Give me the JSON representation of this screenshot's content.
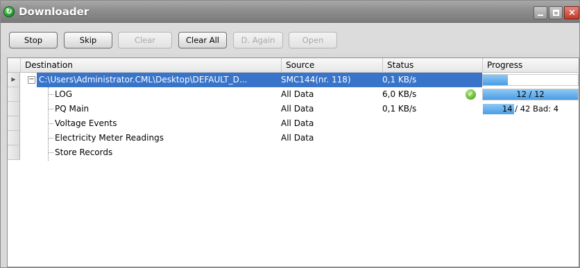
{
  "window": {
    "title": "Downloader"
  },
  "toolbar": {
    "stop": "Stop",
    "skip": "Skip",
    "clear": "Clear",
    "clear_all": "Clear All",
    "d_again": "D. Again",
    "open": "Open"
  },
  "columns": {
    "destination": "Destination",
    "source": "Source",
    "status": "Status",
    "progress": "Progress"
  },
  "rows": [
    {
      "destination": "C:\\Users\\Administrator.CML\\Desktop\\DEFAULT_D...",
      "source": "SMC144(nr. 118)",
      "status": "0,1 KB/s",
      "progress_fraction": 0.26,
      "progress_label": ""
    },
    {
      "destination": "LOG",
      "source": "All Data",
      "status": "6,0 KB/s",
      "progress_fraction": 1.0,
      "progress_label": "12 / 12"
    },
    {
      "destination": "PQ Main",
      "source": "All Data",
      "status": "0,1 KB/s",
      "progress_fraction": 0.33,
      "progress_label": "14 / 42 Bad: 4"
    },
    {
      "destination": "Voltage Events",
      "source": "All Data",
      "status": ""
    },
    {
      "destination": "Electricity Meter Readings",
      "source": "All Data",
      "status": ""
    },
    {
      "destination": "Store Records",
      "source": "",
      "status": ""
    }
  ]
}
